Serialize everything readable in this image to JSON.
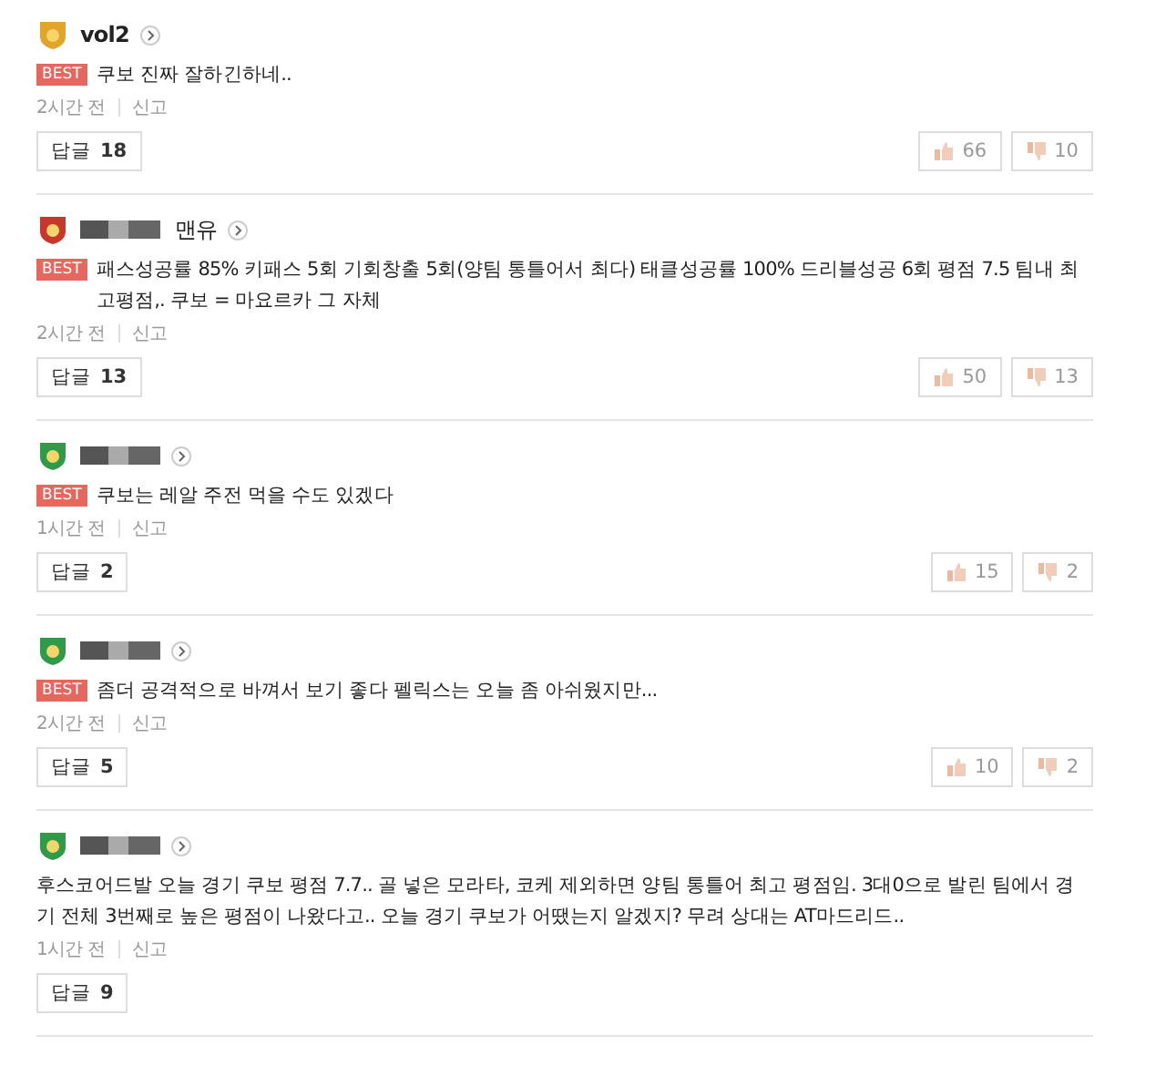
{
  "comments": [
    {
      "color": "#e0a52a",
      "name_hidden": false,
      "name": "vol2",
      "best": true,
      "best_label": "BEST",
      "text": "쿠보 진짜 잘하긴하네..",
      "time": "2시간 전",
      "report": "신고",
      "reply_label": "답글",
      "reply_count": "18",
      "likes": "66",
      "dislikes": "10"
    },
    {
      "color": "#c8372d",
      "name_hidden": true,
      "name": "맨유",
      "best": true,
      "best_label": "BEST",
      "text": "패스성공률 85% 키패스 5회 기회창출 5회(양팀 통틀어서 최다) 태클성공률 100% 드리블성공 6회 평점 7.5 팀내 최고평점,. 쿠보 = 마요르카 그 자체",
      "time": "2시간 전",
      "report": "신고",
      "reply_label": "답글",
      "reply_count": "13",
      "likes": "50",
      "dislikes": "13"
    },
    {
      "color": "#2f9a48",
      "name_hidden": true,
      "best": true,
      "best_label": "BEST",
      "text": "쿠보는 레알 주전 먹을 수도 있겠다",
      "time": "1시간 전",
      "report": "신고",
      "reply_label": "답글",
      "reply_count": "2",
      "likes": "15",
      "dislikes": "2"
    },
    {
      "color": "#2f9a48",
      "name_hidden": true,
      "best": true,
      "best_label": "BEST",
      "text": "좀더 공격적으로 바껴서 보기 좋다 펠릭스는 오늘 좀 아쉬웠지만...",
      "time": "2시간 전",
      "report": "신고",
      "reply_label": "답글",
      "reply_count": "5",
      "likes": "10",
      "dislikes": "2"
    },
    {
      "color": "#2f9a48",
      "name_hidden": true,
      "best": false,
      "text": "후스코어드발 오늘 경기 쿠보 평점 7.7.. 골 넣은 모라타, 코케 제외하면 양팀 통틀어 최고 평점임. 3대0으로 발린 팀에서 경기 전체 3번째로 높은 평점이 나왔다고.. 오늘 경기 쿠보가 어땠는지 알겠지? 무려 상대는 AT마드리드..",
      "time": "1시간 전",
      "report": "신고",
      "reply_label": "답글",
      "reply_count": "9"
    }
  ]
}
